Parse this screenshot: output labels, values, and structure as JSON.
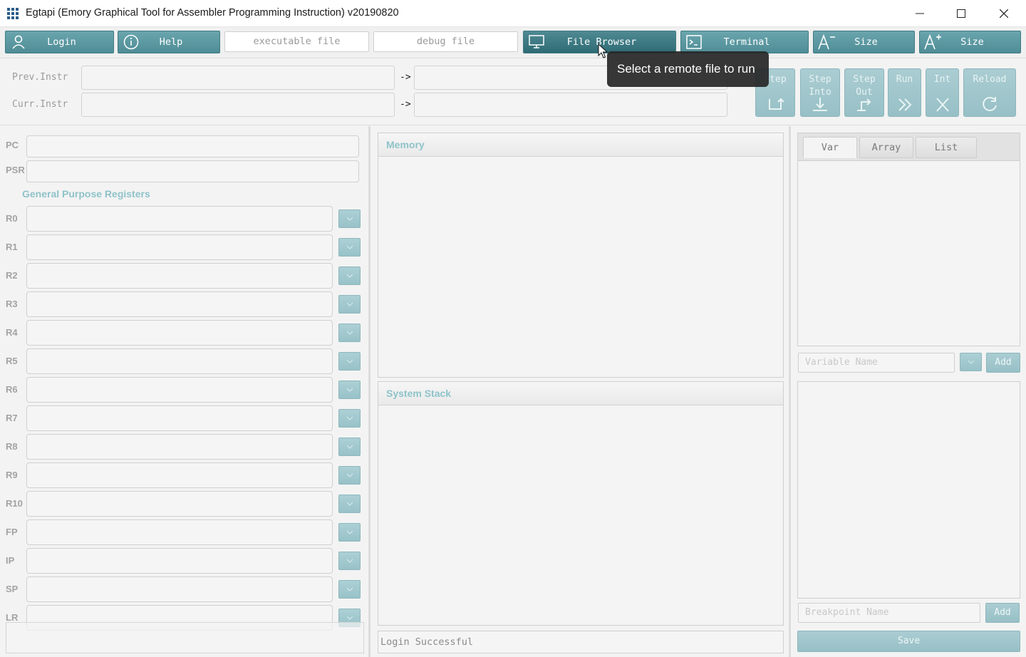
{
  "window": {
    "title": "Egtapi (Emory Graphical Tool for Assembler Programming Instruction) v20190820",
    "app_icon": "grid-icon",
    "controls": [
      "minimize-icon",
      "maximize-icon",
      "close-icon"
    ]
  },
  "toolbar": {
    "login_label": "Login",
    "help_label": "Help",
    "executable_placeholder": "executable file",
    "debug_placeholder": "debug file",
    "file_browser_label": "File Browser",
    "terminal_label": "Terminal",
    "size_decrease_label": "Size",
    "size_increase_label": "Size",
    "accent_color": "#5b979f"
  },
  "tooltip": {
    "text": "Select a remote file to run"
  },
  "instructions": {
    "prev_label": "Prev.Instr",
    "curr_label": "Curr.Instr",
    "arrow": "->"
  },
  "controls": {
    "step_label": "Step",
    "step_into_label": "Step Into",
    "step_out_label": "Step Out",
    "run_label": "Run",
    "int_label": "Int",
    "reload_label": "Reload"
  },
  "registers": {
    "pc_label": "PC",
    "psr_label": "PSR",
    "section_title": "General Purpose Registers",
    "names": [
      "R0",
      "R1",
      "R2",
      "R3",
      "R4",
      "R5",
      "R6",
      "R7",
      "R8",
      "R9",
      "R10",
      "FP",
      "IP",
      "SP",
      "LR"
    ]
  },
  "memory": {
    "title": "Memory"
  },
  "system_stack": {
    "title": "System Stack"
  },
  "status": {
    "message": "Login Successful"
  },
  "watch": {
    "tabs": [
      "Var",
      "Array",
      "List"
    ],
    "variable_placeholder": "Variable Name",
    "add_label": "Add",
    "breakpoint_placeholder": "Breakpoint Name",
    "breakpoint_add_label": "Add",
    "save_label": "Save"
  }
}
